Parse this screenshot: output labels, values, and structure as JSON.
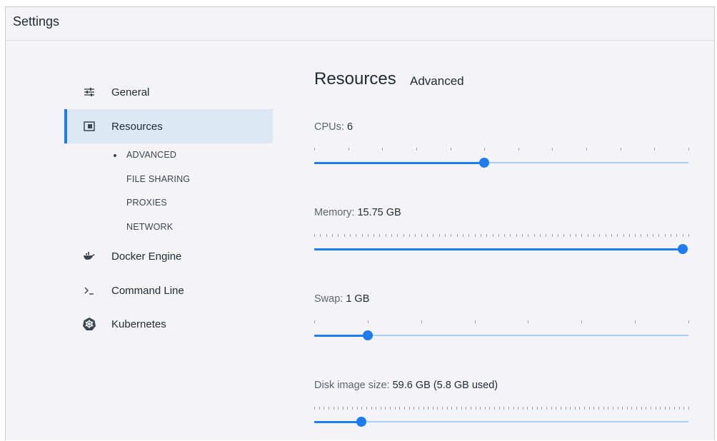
{
  "window": {
    "title": "Settings"
  },
  "sidebar": {
    "items": [
      {
        "label": "General",
        "icon": "sliders-icon"
      },
      {
        "label": "Resources",
        "icon": "resources-icon",
        "active": true
      },
      {
        "label": "Docker Engine",
        "icon": "whale-icon"
      },
      {
        "label": "Command Line",
        "icon": "terminal-icon"
      },
      {
        "label": "Kubernetes",
        "icon": "kubernetes-icon"
      }
    ],
    "sub_items": [
      {
        "label": "ADVANCED",
        "active": true
      },
      {
        "label": "FILE SHARING"
      },
      {
        "label": "PROXIES"
      },
      {
        "label": "NETWORK"
      }
    ]
  },
  "main": {
    "title": "Resources",
    "subtitle": "Advanced",
    "resources": [
      {
        "label": "CPUs:",
        "value": "6",
        "level": 0.454
      },
      {
        "label": "Memory:",
        "value": "15.75 GB",
        "level": 0.985
      },
      {
        "label": "Swap:",
        "value": "1 GB",
        "level": 0.143
      },
      {
        "label": "Disk image size:",
        "value": "59.6 GB (5.8 GB used)",
        "level": 0.126
      }
    ]
  },
  "colors": {
    "accent": "#1c7cf0",
    "track": "#a9cdf6",
    "active_bg": "#dce9f5"
  }
}
